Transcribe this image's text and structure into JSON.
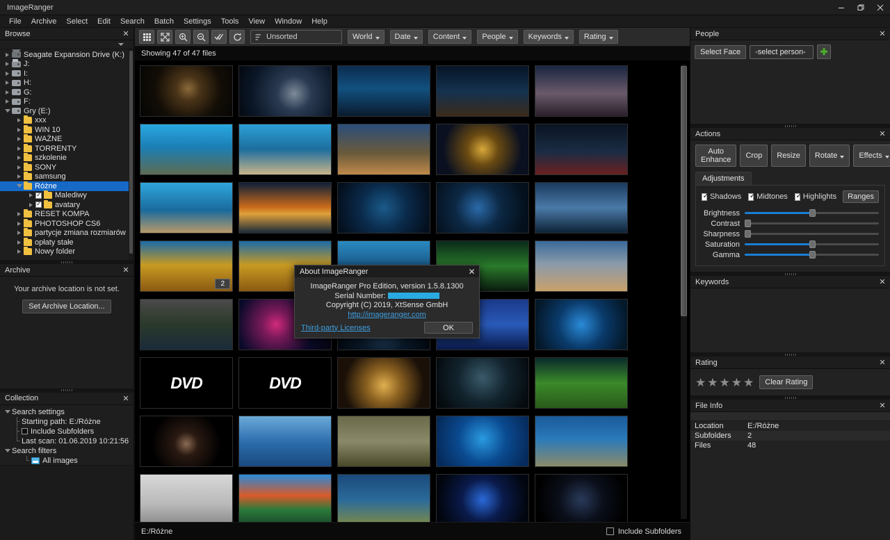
{
  "window": {
    "title": "ImageRanger",
    "minimize": "–",
    "restore": "❐",
    "close": "✕"
  },
  "menubar": [
    "File",
    "Archive",
    "Select",
    "Edit",
    "Search",
    "Batch",
    "Settings",
    "Tools",
    "View",
    "Window",
    "Help"
  ],
  "browse": {
    "title": "Browse",
    "close": "✕",
    "tree": [
      {
        "label": "Seagate Expansion Drive (K:)",
        "depth": 0,
        "icon": "drive-ext",
        "arrow": "closed"
      },
      {
        "label": "J:",
        "depth": 0,
        "icon": "drive-net",
        "arrow": "closed"
      },
      {
        "label": "I:",
        "depth": 0,
        "icon": "drive",
        "arrow": "closed"
      },
      {
        "label": "H:",
        "depth": 0,
        "icon": "drive",
        "arrow": "closed"
      },
      {
        "label": "G:",
        "depth": 0,
        "icon": "drive",
        "arrow": "closed"
      },
      {
        "label": "F:",
        "depth": 0,
        "icon": "drive",
        "arrow": "closed"
      },
      {
        "label": "Gry (E:)",
        "depth": 0,
        "icon": "drive",
        "arrow": "open"
      },
      {
        "label": "xxx",
        "depth": 1,
        "icon": "folder",
        "arrow": "closed"
      },
      {
        "label": "WIN 10",
        "depth": 1,
        "icon": "folder",
        "arrow": "closed"
      },
      {
        "label": "WAŻNE",
        "depth": 1,
        "icon": "folder",
        "arrow": "closed"
      },
      {
        "label": "TORRENTY",
        "depth": 1,
        "icon": "folder",
        "arrow": "closed"
      },
      {
        "label": "szkolenie",
        "depth": 1,
        "icon": "folder",
        "arrow": "closed"
      },
      {
        "label": "SONY",
        "depth": 1,
        "icon": "folder",
        "arrow": "closed"
      },
      {
        "label": "samsung",
        "depth": 1,
        "icon": "folder",
        "arrow": "closed"
      },
      {
        "label": "Różne",
        "depth": 1,
        "icon": "folder",
        "arrow": "open",
        "selected": true
      },
      {
        "label": "Malediwy",
        "depth": 2,
        "icon": "folder",
        "arrow": "closed",
        "checkbox": true
      },
      {
        "label": "avatary",
        "depth": 2,
        "icon": "folder",
        "arrow": "closed",
        "checkbox": true
      },
      {
        "label": "RESET KOMPA",
        "depth": 1,
        "icon": "folder",
        "arrow": "closed"
      },
      {
        "label": "PHOTOSHOP CS6",
        "depth": 1,
        "icon": "folder",
        "arrow": "closed"
      },
      {
        "label": "partycje zmiana rozmiarów",
        "depth": 1,
        "icon": "folder",
        "arrow": "closed"
      },
      {
        "label": "opłaty stałe",
        "depth": 1,
        "icon": "folder",
        "arrow": "closed"
      },
      {
        "label": "Nowy folder",
        "depth": 1,
        "icon": "folder",
        "arrow": "closed"
      }
    ]
  },
  "archive": {
    "title": "Archive",
    "close": "✕",
    "message": "Your archive location is not set.",
    "set_button": "Set Archive Location..."
  },
  "collection": {
    "title": "Collection",
    "close": "✕",
    "rows": [
      {
        "label": "Search settings",
        "depth": 0,
        "arrow": "open"
      },
      {
        "label": "Starting path: E:/Różne",
        "depth": 1,
        "guide": "├"
      },
      {
        "label": "Include Subfolders",
        "depth": 1,
        "guide": "├",
        "checkbox": true
      },
      {
        "label": "Last scan: 01.06.2019 10:21:56",
        "depth": 1,
        "guide": "└"
      },
      {
        "label": "Search filters",
        "depth": 0,
        "arrow": "open"
      },
      {
        "label": "All images",
        "depth": 2,
        "guide": "└",
        "image_icon": true
      }
    ]
  },
  "toolbar": {
    "buttons": [
      {
        "name": "grid-view-icon",
        "title": "Grid view"
      },
      {
        "name": "fullscreen-icon",
        "title": "Fullscreen"
      },
      {
        "name": "zoom-in-icon",
        "title": "Zoom in"
      },
      {
        "name": "zoom-out-icon",
        "title": "Zoom out"
      },
      {
        "name": "select-all-icon",
        "title": "Select all"
      },
      {
        "name": "refresh-icon",
        "title": "Refresh"
      }
    ],
    "sort_value": "Unsorted",
    "dropdowns": [
      "World",
      "Date",
      "Content",
      "People",
      "Keywords",
      "Rating"
    ]
  },
  "main": {
    "status": "Showing 47 of 47 files",
    "path": "E:/Różne",
    "include_subfolders_label": "Include Subfolders",
    "thumbnails": [
      {
        "name": "lion",
        "badge": null
      },
      {
        "name": "starship-planet",
        "badge": null
      },
      {
        "name": "blue-mountains",
        "badge": null
      },
      {
        "name": "pyramid-night",
        "badge": null
      },
      {
        "name": "storm-tree",
        "badge": null
      },
      {
        "name": "aquarium-rocks",
        "badge": null
      },
      {
        "name": "coral-reef",
        "badge": null
      },
      {
        "name": "pyramids-desert",
        "badge": null
      },
      {
        "name": "gold-spiral",
        "badge": null
      },
      {
        "name": "red-car-city",
        "badge": null
      },
      {
        "name": "reef-blue",
        "badge": null
      },
      {
        "name": "sunset-sea",
        "badge": null
      },
      {
        "name": "arabic-calligraphy",
        "badge": null
      },
      {
        "name": "blue-abstract",
        "badge": null
      },
      {
        "name": "clouds-sky",
        "badge": null
      },
      {
        "name": "coral-yellow",
        "badge": "2"
      },
      {
        "name": "coral-yellow-2",
        "badge": null
      },
      {
        "name": "underwater-purple",
        "badge": null
      },
      {
        "name": "green-plants",
        "badge": null
      },
      {
        "name": "pyramids-clouds",
        "badge": null
      },
      {
        "name": "trucks",
        "badge": null
      },
      {
        "name": "neon-smoke",
        "badge": null
      },
      {
        "name": "agency-emblem",
        "badge": null
      },
      {
        "name": "mickey-mouse",
        "badge": null
      },
      {
        "name": "water-drop-blue",
        "badge": null
      },
      {
        "name": "dvd-video-1",
        "badge": null
      },
      {
        "name": "dvd-video-2",
        "badge": null
      },
      {
        "name": "golden-pyramid",
        "badge": null
      },
      {
        "name": "dark-cave",
        "badge": null
      },
      {
        "name": "green-aquarium",
        "badge": null
      },
      {
        "name": "hand-dark",
        "badge": null
      },
      {
        "name": "mountain-lake",
        "badge": null
      },
      {
        "name": "hummingbird",
        "badge": null
      },
      {
        "name": "padi-logo",
        "badge": null
      },
      {
        "name": "aquarium-stones",
        "badge": null
      },
      {
        "name": "white-figure",
        "badge": null
      },
      {
        "name": "red-mountains",
        "badge": null
      },
      {
        "name": "aquarium-plants",
        "badge": null
      },
      {
        "name": "dark-blue-glow",
        "badge": null
      },
      {
        "name": "nsa-seal",
        "badge": null
      }
    ]
  },
  "people": {
    "title": "People",
    "close": "✕",
    "select_face": "Select Face",
    "person_value": "-select person-",
    "add": "✚"
  },
  "actions": {
    "title": "Actions",
    "close": "✕",
    "buttons": [
      "Auto Enhance",
      "Crop",
      "Resize"
    ],
    "dropdowns": [
      "Rotate",
      "Effects"
    ],
    "adjustments_label": "Adjustments",
    "tab": "Adjustments",
    "ranges_button": "Ranges",
    "checkboxes": [
      {
        "label": "Shadows",
        "checked": true
      },
      {
        "label": "Midtones",
        "checked": true
      },
      {
        "label": "Highlights",
        "checked": true
      }
    ],
    "sliders": [
      {
        "label": "Brightness",
        "percent": 50
      },
      {
        "label": "Contrast",
        "percent": 0
      },
      {
        "label": "Sharpness",
        "percent": 0
      },
      {
        "label": "Saturation",
        "percent": 50
      },
      {
        "label": "Gamma",
        "percent": 50
      }
    ]
  },
  "keywords": {
    "title": "Keywords",
    "close": "✕"
  },
  "rating": {
    "title": "Rating",
    "close": "✕",
    "stars": [
      "★",
      "★",
      "★",
      "★",
      "★"
    ],
    "clear_button": "Clear Rating"
  },
  "file_info": {
    "title": "File Info",
    "close": "✕",
    "rows": [
      {
        "key": "Location",
        "value": "E:/Różne"
      },
      {
        "key": "Subfolders",
        "value": "2"
      },
      {
        "key": "Files",
        "value": "48"
      }
    ]
  },
  "about_dialog": {
    "title": "About ImageRanger",
    "close": "✕",
    "line1": "ImageRanger Pro Edition, version 1.5.8.1300",
    "serial_label": "Serial Number:",
    "copyright": "Copyright (C) 2019, XtSense GmbH",
    "url": "http://imageranger.com",
    "licenses_link": "Third-party Licenses",
    "ok_button": "OK"
  },
  "colors": {
    "accent": "#1669c6",
    "slider": "#1a7fd4",
    "link": "#3f9fe0",
    "folder": "#f0c040",
    "serial_highlight": "#29abe2"
  }
}
